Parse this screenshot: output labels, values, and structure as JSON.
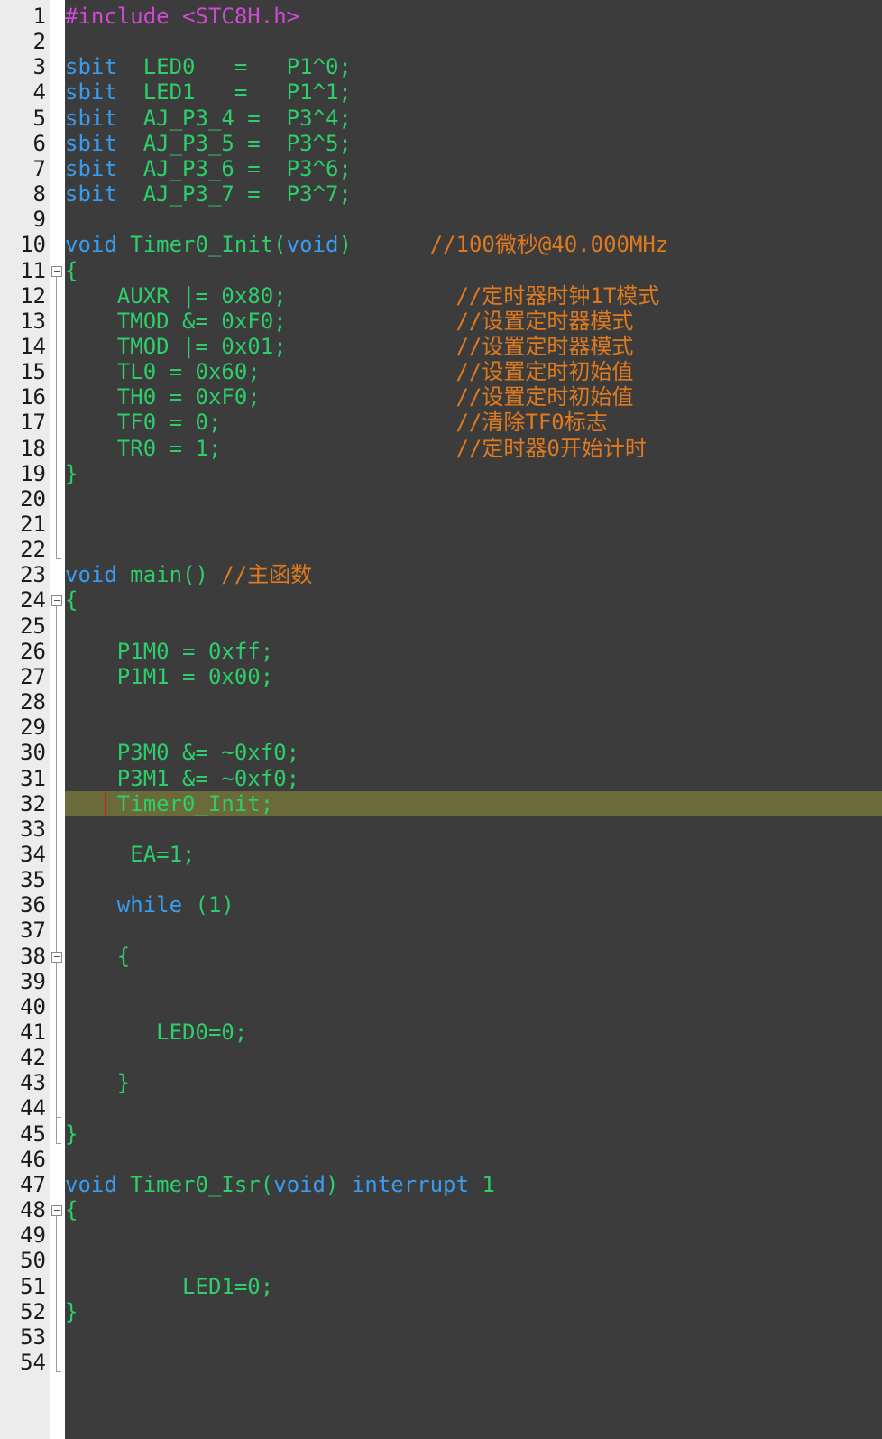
{
  "editor": {
    "colors": {
      "keyword": "#3a9cf0",
      "ident": "#2ccf6a",
      "comment": "#e07a1f",
      "preproc": "#d04ad6",
      "punct": "#2ccf6a",
      "highlight": "#6b6a3a"
    },
    "lines": [
      {
        "n": "1",
        "tokens": [
          {
            "t": "#include <STC8H.h>",
            "c": "preproc"
          }
        ]
      },
      {
        "n": "2",
        "tokens": []
      },
      {
        "n": "3",
        "tokens": [
          {
            "t": "sbit",
            "c": "keyword"
          },
          {
            "t": "  LED0   =   P1^0;",
            "c": "ident"
          }
        ]
      },
      {
        "n": "4",
        "tokens": [
          {
            "t": "sbit",
            "c": "keyword"
          },
          {
            "t": "  LED1   =   P1^1;",
            "c": "ident"
          }
        ]
      },
      {
        "n": "5",
        "tokens": [
          {
            "t": "sbit",
            "c": "keyword"
          },
          {
            "t": "  AJ_P3_4 =  P3^4;",
            "c": "ident"
          }
        ]
      },
      {
        "n": "6",
        "tokens": [
          {
            "t": "sbit",
            "c": "keyword"
          },
          {
            "t": "  AJ_P3_5 =  P3^5;",
            "c": "ident"
          }
        ]
      },
      {
        "n": "7",
        "tokens": [
          {
            "t": "sbit",
            "c": "keyword"
          },
          {
            "t": "  AJ_P3_6 =  P3^6;",
            "c": "ident"
          }
        ]
      },
      {
        "n": "8",
        "tokens": [
          {
            "t": "sbit",
            "c": "keyword"
          },
          {
            "t": "  AJ_P3_7 =  P3^7;",
            "c": "ident"
          }
        ]
      },
      {
        "n": "9",
        "tokens": []
      },
      {
        "n": "10",
        "tokens": [
          {
            "t": "void",
            "c": "keyword"
          },
          {
            "t": " Timer0_Init(",
            "c": "ident"
          },
          {
            "t": "void",
            "c": "keyword"
          },
          {
            "t": ")      ",
            "c": "ident"
          },
          {
            "t": "//100微秒@40.000MHz",
            "c": "comment"
          }
        ]
      },
      {
        "n": "11",
        "tokens": [
          {
            "t": "{",
            "c": "ident"
          }
        ]
      },
      {
        "n": "12",
        "tokens": [
          {
            "t": "    AUXR |= 0x80;             ",
            "c": "ident"
          },
          {
            "t": "//定时器时钟1T模式",
            "c": "comment"
          }
        ]
      },
      {
        "n": "13",
        "tokens": [
          {
            "t": "    TMOD &= 0xF0;             ",
            "c": "ident"
          },
          {
            "t": "//设置定时器模式",
            "c": "comment"
          }
        ]
      },
      {
        "n": "14",
        "tokens": [
          {
            "t": "    TMOD |= 0x01;             ",
            "c": "ident"
          },
          {
            "t": "//设置定时器模式",
            "c": "comment"
          }
        ]
      },
      {
        "n": "15",
        "tokens": [
          {
            "t": "    TL0 = 0x60;               ",
            "c": "ident"
          },
          {
            "t": "//设置定时初始值",
            "c": "comment"
          }
        ]
      },
      {
        "n": "16",
        "tokens": [
          {
            "t": "    TH0 = 0xF0;               ",
            "c": "ident"
          },
          {
            "t": "//设置定时初始值",
            "c": "comment"
          }
        ]
      },
      {
        "n": "17",
        "tokens": [
          {
            "t": "    TF0 = 0;                  ",
            "c": "ident"
          },
          {
            "t": "//清除TF0标志",
            "c": "comment"
          }
        ]
      },
      {
        "n": "18",
        "tokens": [
          {
            "t": "    TR0 = 1;                  ",
            "c": "ident"
          },
          {
            "t": "//定时器0开始计时",
            "c": "comment"
          }
        ]
      },
      {
        "n": "19",
        "tokens": [
          {
            "t": "}",
            "c": "ident"
          }
        ]
      },
      {
        "n": "20",
        "tokens": []
      },
      {
        "n": "21",
        "tokens": []
      },
      {
        "n": "22",
        "tokens": []
      },
      {
        "n": "23",
        "tokens": [
          {
            "t": "void",
            "c": "keyword"
          },
          {
            "t": " main() ",
            "c": "ident"
          },
          {
            "t": "//主函数",
            "c": "comment"
          }
        ]
      },
      {
        "n": "24",
        "tokens": [
          {
            "t": "{",
            "c": "ident"
          }
        ]
      },
      {
        "n": "25",
        "tokens": []
      },
      {
        "n": "26",
        "tokens": [
          {
            "t": "    P1M0 = 0xff;",
            "c": "ident"
          }
        ]
      },
      {
        "n": "27",
        "tokens": [
          {
            "t": "    P1M1 = 0x00;",
            "c": "ident"
          }
        ]
      },
      {
        "n": "28",
        "tokens": []
      },
      {
        "n": "29",
        "tokens": []
      },
      {
        "n": "30",
        "tokens": [
          {
            "t": "    P3M0 &= ~0xf0;",
            "c": "ident"
          }
        ]
      },
      {
        "n": "31",
        "tokens": [
          {
            "t": "    P3M1 &= ~0xf0;",
            "c": "ident"
          }
        ]
      },
      {
        "n": "32",
        "tokens": [
          {
            "t": "    Timer0_Init;",
            "c": "ident"
          }
        ],
        "hl": true
      },
      {
        "n": "33",
        "tokens": []
      },
      {
        "n": "34",
        "tokens": [
          {
            "t": "     EA=1;",
            "c": "ident"
          }
        ]
      },
      {
        "n": "35",
        "tokens": []
      },
      {
        "n": "36",
        "tokens": [
          {
            "t": "    ",
            "c": "ident"
          },
          {
            "t": "while",
            "c": "keyword"
          },
          {
            "t": " (1)",
            "c": "ident"
          }
        ]
      },
      {
        "n": "37",
        "tokens": []
      },
      {
        "n": "38",
        "tokens": [
          {
            "t": "    {",
            "c": "ident"
          }
        ]
      },
      {
        "n": "39",
        "tokens": []
      },
      {
        "n": "40",
        "tokens": []
      },
      {
        "n": "41",
        "tokens": [
          {
            "t": "       LED0=0;",
            "c": "ident"
          }
        ]
      },
      {
        "n": "42",
        "tokens": []
      },
      {
        "n": "43",
        "tokens": [
          {
            "t": "    }",
            "c": "ident"
          }
        ]
      },
      {
        "n": "44",
        "tokens": []
      },
      {
        "n": "45",
        "tokens": [
          {
            "t": "}",
            "c": "ident"
          }
        ]
      },
      {
        "n": "46",
        "tokens": []
      },
      {
        "n": "47",
        "tokens": [
          {
            "t": "void",
            "c": "keyword"
          },
          {
            "t": " Timer0_Isr(",
            "c": "ident"
          },
          {
            "t": "void",
            "c": "keyword"
          },
          {
            "t": ") ",
            "c": "ident"
          },
          {
            "t": "interrupt",
            "c": "keyword"
          },
          {
            "t": " 1",
            "c": "ident"
          }
        ]
      },
      {
        "n": "48",
        "tokens": [
          {
            "t": "{",
            "c": "ident"
          }
        ]
      },
      {
        "n": "49",
        "tokens": []
      },
      {
        "n": "50",
        "tokens": []
      },
      {
        "n": "51",
        "tokens": [
          {
            "t": "         LED1=0;",
            "c": "ident"
          }
        ]
      },
      {
        "n": "52",
        "tokens": [
          {
            "t": "}",
            "c": "ident"
          }
        ]
      },
      {
        "n": "53",
        "tokens": []
      },
      {
        "n": "54",
        "tokens": []
      }
    ]
  }
}
